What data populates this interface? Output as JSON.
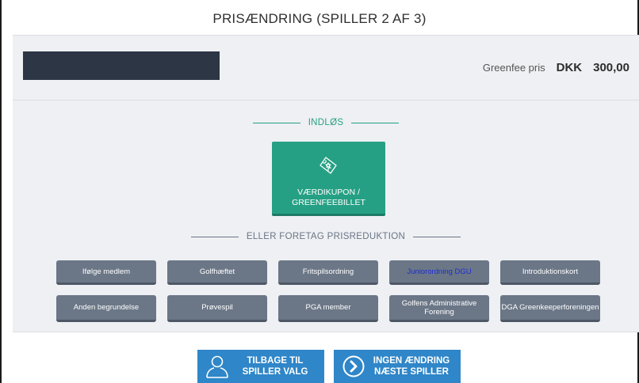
{
  "title": "PRISÆNDRING (SPILLER 2 AF 3)",
  "price": {
    "label": "Greenfee pris",
    "currency": "DKK",
    "amount": "300,00"
  },
  "sections": {
    "entry": "INDLØS",
    "reduction": "ELLER FORETAG PRISREDUKTION"
  },
  "voucher": {
    "line1": "VÆRDIKUPON /",
    "line2": "GREENFEEBILLET",
    "icon": "ticket-icon"
  },
  "reductions": [
    {
      "label": "Ifølge medlem"
    },
    {
      "label": "Golfhæftet"
    },
    {
      "label": "Fritspilsordning"
    },
    {
      "label": "Juniorordning DGU"
    },
    {
      "label": "Introduktionskort"
    },
    {
      "label": "Anden begrundelse"
    },
    {
      "label": "Prøvespil"
    },
    {
      "label": "PGA member"
    },
    {
      "label": "Golfens Administrative Forening"
    },
    {
      "label": "DGA Greenkeeperforeningen"
    }
  ],
  "actions": {
    "back": {
      "line1": "TILBAGE TIL",
      "line2": "SPILLER VALG",
      "icon": "user-icon"
    },
    "next": {
      "line1": "INGEN ÆNDRING",
      "line2": "NÆSTE SPILLER",
      "icon": "chevron-right-circle-icon"
    }
  },
  "colors": {
    "accent_green": "#26a084",
    "button_gray": "#6b7787",
    "action_blue": "#2f86c8",
    "name_bar": "#2c3645",
    "highlight_text": "#1c2bd8"
  }
}
